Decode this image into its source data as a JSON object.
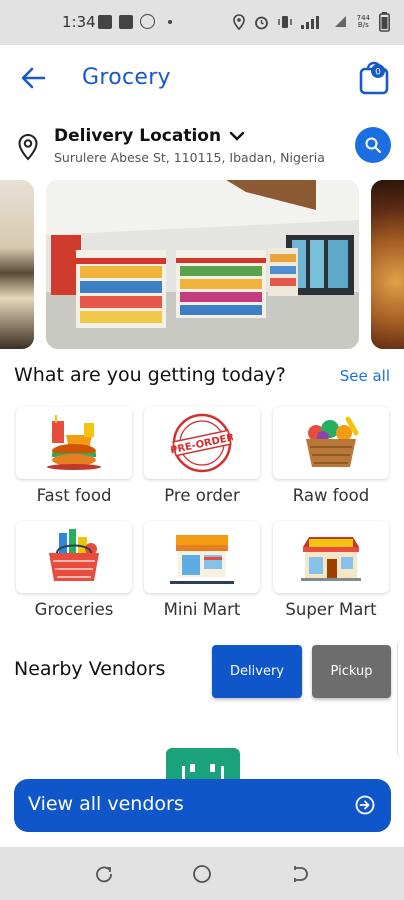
{
  "status_bar": {
    "time": "1:34",
    "network_speed_top": "744",
    "network_speed_bottom": "B/s",
    "icons": [
      "t-app-icon",
      "facebook-icon",
      "shazam-icon",
      "location-icon",
      "alarm-icon",
      "vibrate-icon",
      "signal-icon",
      "wifi-icon",
      "battery-icon"
    ]
  },
  "app_bar": {
    "title": "Grocery",
    "cart_count": "0",
    "accent_color": "#1659c7"
  },
  "delivery": {
    "label": "Delivery Location",
    "address": "Surulere Abese St, 110115, Ibadan, Nigeria"
  },
  "carousel": {
    "slides": [
      "grains-market-image",
      "grocery-store-interior-image",
      "cooked-food-image"
    ]
  },
  "categories_section": {
    "title": "What are you getting today?",
    "see_all": "See all",
    "items": [
      {
        "label": "Fast food",
        "icon": "fast-food-icon"
      },
      {
        "label": "Pre order",
        "icon": "pre-order-stamp-icon"
      },
      {
        "label": "Raw food",
        "icon": "vegetable-basket-icon"
      },
      {
        "label": "Groceries",
        "icon": "grocery-basket-icon"
      },
      {
        "label": "Mini Mart",
        "icon": "mini-mart-icon"
      },
      {
        "label": "Super Mart",
        "icon": "super-mart-icon"
      }
    ],
    "stamp_text": "PRE-ORDER"
  },
  "vendors": {
    "title": "Nearby Vendors",
    "delivery_label": "Delivery",
    "pickup_label": "Pickup",
    "view_all_label": "View all vendors"
  },
  "colors": {
    "primary_blue": "#0e56c9",
    "search_blue": "#1c6fe0",
    "pickup_grey": "#6d6d6d",
    "vendor_green": "#1aa37a"
  }
}
